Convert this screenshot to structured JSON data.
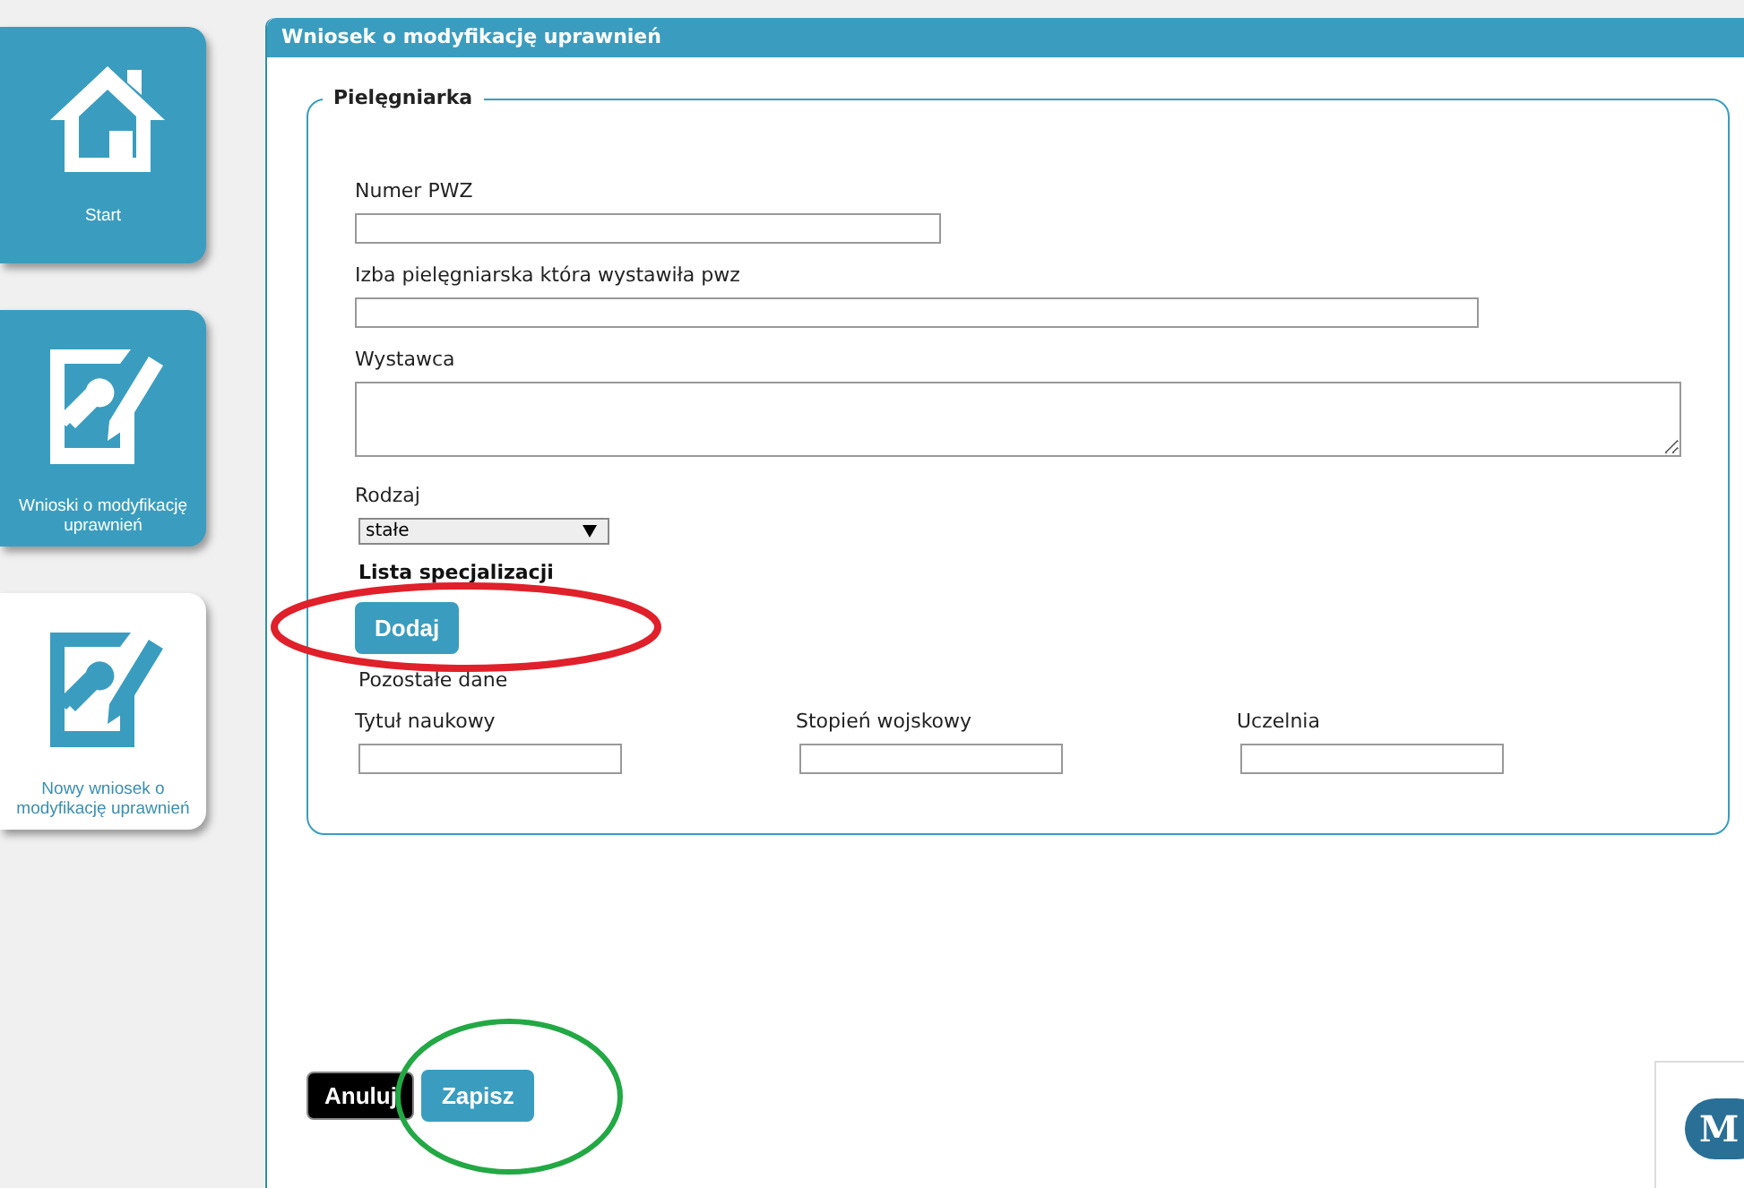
{
  "sidebar": {
    "items": [
      {
        "label": "Start",
        "selected": false
      },
      {
        "label": "Wnioski o modyfikację uprawnień",
        "selected": false
      },
      {
        "label": "Nowy wniosek o modyfikację uprawnień",
        "selected": true
      }
    ]
  },
  "panel": {
    "title": "Wniosek o modyfikację uprawnień",
    "fieldset": {
      "legend": "Pielęgniarka",
      "fields": [
        {
          "kind": "input",
          "label": "Numer PWZ"
        },
        {
          "kind": "input",
          "label": "Izba pielęgniarska która wystawiła pwz"
        },
        {
          "kind": "textarea",
          "label": "Wystawca"
        },
        {
          "kind": "select",
          "label": "Rodzaj",
          "value": "stałe"
        }
      ],
      "specializations": {
        "heading": "Lista specjalizacji",
        "button": "Dodaj"
      },
      "other": {
        "heading": "Pozostałe dane",
        "fields": [
          {
            "label": "Tytuł naukowy"
          },
          {
            "label": "Stopień wojskowy"
          },
          {
            "label": "Uczelnia"
          }
        ]
      }
    },
    "buttons": [
      {
        "kind": "cancel",
        "label": "Anuluj"
      },
      {
        "kind": "save",
        "label": "Zapisz"
      }
    ]
  },
  "chat_widget": {
    "letter": "M"
  }
}
